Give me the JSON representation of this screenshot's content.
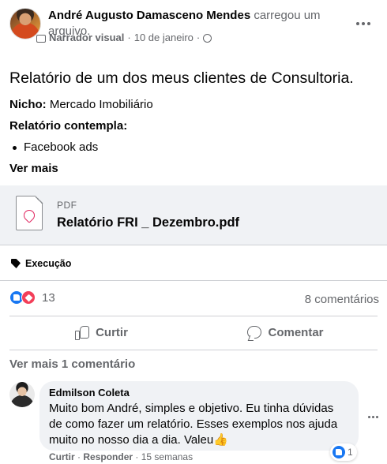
{
  "post": {
    "author": "André Augusto Damasceno Mendes",
    "action": "carregou um arquivo.",
    "group": "Narrador visual",
    "date": "10 de janeiro",
    "separator": "·",
    "title": "Relatório de um dos meus clientes de Consultoria.",
    "niche_label": "Nicho:",
    "niche_value": "Mercado Imobiliário",
    "report_label": "Relatório contempla:",
    "bullets": [
      "Facebook ads"
    ],
    "see_more": "Ver mais"
  },
  "attachment": {
    "type": "PDF",
    "name": "Relatório FRI _ Dezembro.pdf"
  },
  "topic": "Execução",
  "reactions": {
    "count": "13",
    "comments": "8 comentários"
  },
  "actions": {
    "like": "Curtir",
    "comment": "Comentar"
  },
  "comments_section": {
    "see_more": "Ver mais 1 comentário"
  },
  "comment": {
    "author": "Edmilson Coleta",
    "text": "Muito bom André, simples e objetivo. Eu tinha dúvidas de como fazer um relatório. Esses exemplos nos ajuda muito no nosso dia a dia. Valeu👍",
    "reaction_count": "1",
    "like": "Curtir",
    "reply": "Responder",
    "time": "15 semanas",
    "separator": "·"
  },
  "colors": {
    "accent": "#1877f2",
    "love": "#f33e58",
    "secondary_text": "#65676b",
    "attachment_bg": "#f0f2f5"
  }
}
